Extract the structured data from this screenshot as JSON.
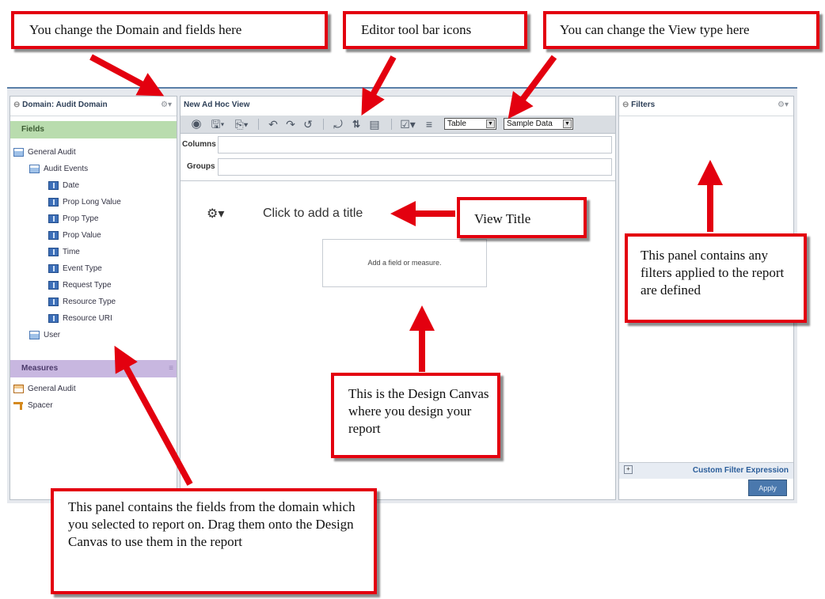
{
  "callouts": {
    "domain": "You change the Domain and fields  here",
    "toolbar": "Editor tool bar icons",
    "view_type": "You can change the View type here",
    "view_title": "View Title",
    "filters": "This panel contains any filters applied to the report are defined",
    "canvas": "This is the Design Canvas where you design your report",
    "fields_panel": "This panel contains the fields  from the domain which you selected to report on. Drag them onto the Design Canvas to use them in the report"
  },
  "left_panel": {
    "title": "Domain: Audit Domain",
    "fields_header": "Fields",
    "measures_header": "Measures",
    "fields_tree": [
      {
        "label": "General Audit",
        "icon": "table-icon"
      },
      {
        "label": "Audit Events",
        "icon": "table-icon"
      },
      {
        "label": "Date",
        "icon": "field-icon"
      },
      {
        "label": "Prop Long Value",
        "icon": "field-icon"
      },
      {
        "label": "Prop Type",
        "icon": "field-icon"
      },
      {
        "label": "Prop Value",
        "icon": "field-icon"
      },
      {
        "label": "Time",
        "icon": "field-icon"
      },
      {
        "label": "Event Type",
        "icon": "field-icon"
      },
      {
        "label": "Request Type",
        "icon": "field-icon"
      },
      {
        "label": "Resource Type",
        "icon": "field-icon"
      },
      {
        "label": "Resource URI",
        "icon": "field-icon"
      },
      {
        "label": "User",
        "icon": "table-icon"
      }
    ],
    "measures_tree": [
      {
        "label": "General Audit",
        "icon": "measure-table-icon"
      },
      {
        "label": "Spacer",
        "icon": "spacer-icon"
      }
    ]
  },
  "center_panel": {
    "title": "New Ad Hoc View",
    "view_type": "Table",
    "data_mode": "Sample Data",
    "columns_label": "Columns",
    "groups_label": "Groups",
    "canvas_title": "Click to add a title",
    "canvas_placeholder": "Add a field or measure."
  },
  "right_panel": {
    "title": "Filters",
    "custom_filter": "Custom Filter Expression",
    "apply": "Apply"
  },
  "colors": {
    "callout_red": "#e3000f",
    "fields_green": "#b9dcae",
    "measures_purple": "#c8b7e0",
    "apply_blue": "#4a78ad"
  }
}
